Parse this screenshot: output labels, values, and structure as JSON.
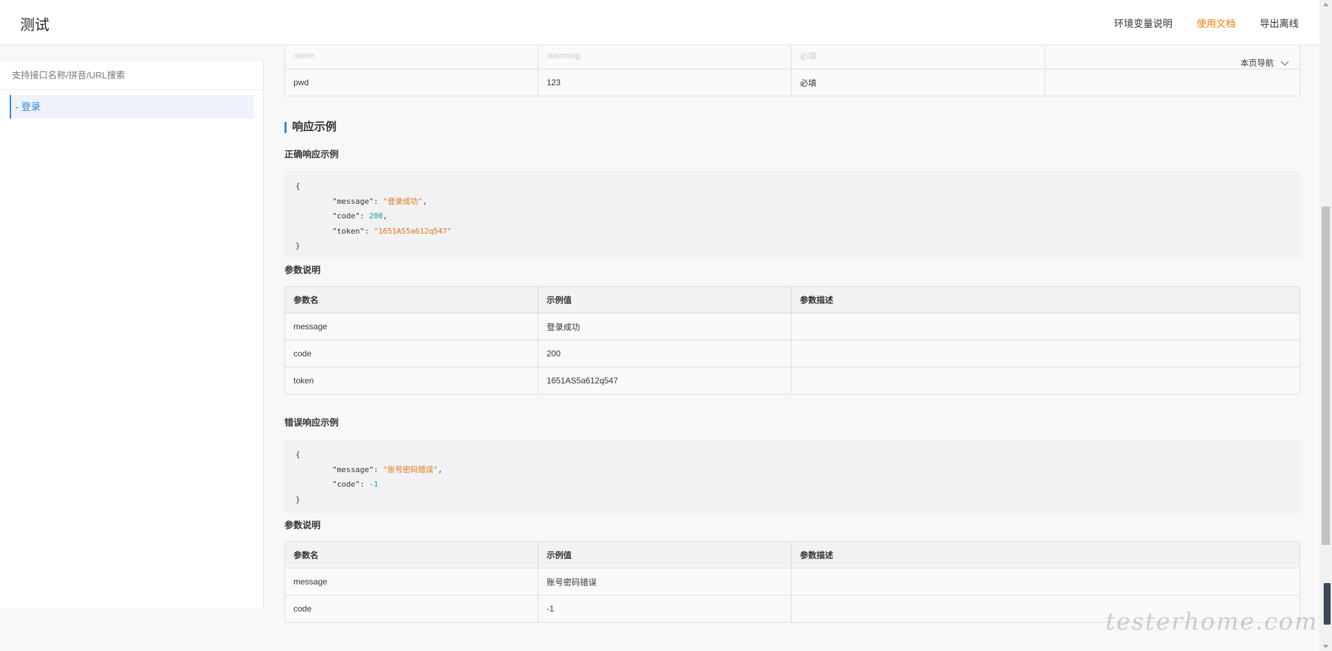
{
  "header": {
    "title": "测试",
    "nav": [
      "环境变量说明",
      "使用文档",
      "导出离线"
    ]
  },
  "sidebar": {
    "search_placeholder": "支持接口名称/拼音/URL搜索",
    "items": [
      {
        "label": "- 登录"
      }
    ]
  },
  "main": {
    "page_nav_label": "本页导航",
    "request_table": {
      "faded_row": [
        "name",
        "xiaoming",
        "必填",
        ""
      ],
      "rows": [
        [
          "pwd",
          "123",
          "必填",
          ""
        ]
      ]
    },
    "response_section_title": "响应示例",
    "success": {
      "title": "正确响应示例",
      "code": {
        "open": "{",
        "lines": [
          {
            "key": "\"message\"",
            "value": "\"登录成功\"",
            "type": "str",
            "comma": ","
          },
          {
            "key": "\"code\"",
            "value": "200",
            "type": "num",
            "comma": ","
          },
          {
            "key": "\"token\"",
            "value": "\"1651AS5a612q547\"",
            "type": "str",
            "comma": ""
          }
        ],
        "close": "}"
      },
      "params_title": "参数说明",
      "headers": [
        "参数名",
        "示例值",
        "参数描述"
      ],
      "rows": [
        [
          "message",
          "登录成功",
          ""
        ],
        [
          "code",
          "200",
          ""
        ],
        [
          "token",
          "1651AS5a612q547",
          ""
        ]
      ]
    },
    "error": {
      "title": "错误响应示例",
      "code": {
        "open": "{",
        "lines": [
          {
            "key": "\"message\"",
            "value": "\"账号密码错误\"",
            "type": "str",
            "comma": ","
          },
          {
            "key": "\"code\"",
            "value": "-1",
            "type": "num",
            "comma": ""
          }
        ],
        "close": "}"
      },
      "params_title": "参数说明",
      "headers": [
        "参数名",
        "示例值",
        "参数描述"
      ],
      "rows": [
        [
          "message",
          "账号密码错误",
          ""
        ],
        [
          "code",
          "-1",
          ""
        ]
      ]
    }
  },
  "watermark": "testerhome.com",
  "colors": {
    "accent": "#2f84d7",
    "active_nav": "#ff7a00",
    "json_string": "#e4750f",
    "json_number": "#1d9aa6"
  }
}
